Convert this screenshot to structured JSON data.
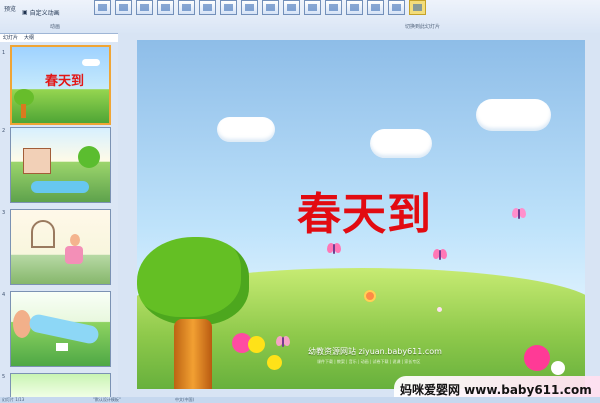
{
  "ribbon": {
    "left_label": "预览",
    "left_button": "自定义动画",
    "group_left": "动画",
    "group_right": "切换到此幻灯片",
    "icons": [
      "transition-1",
      "transition-2",
      "transition-3",
      "transition-4",
      "transition-5",
      "transition-6",
      "transition-7",
      "transition-8",
      "transition-9",
      "transition-10",
      "transition-11",
      "transition-12",
      "transition-13",
      "transition-14",
      "transition-15",
      "transition-16"
    ]
  },
  "thumbnail_pane": {
    "tabs": [
      "幻灯片",
      "大纲"
    ],
    "slides": [
      {
        "num": "1",
        "type": "title"
      },
      {
        "num": "2",
        "type": "village"
      },
      {
        "num": "3",
        "type": "window"
      },
      {
        "num": "4",
        "type": "river"
      },
      {
        "num": "5",
        "type": "partial"
      }
    ]
  },
  "slide": {
    "title": "春天到",
    "site_text": "幼教资源网站 ziyuan.baby611.com",
    "small_text": "课件下载 | 教案 | 音乐 | 动画 | 试卷下载 | 说课 | 家长专区"
  },
  "watermark": {
    "text": "妈咪爱婴网 www.baby611.com"
  },
  "statusbar": {
    "left": "幻灯片 1/13",
    "center": "\"默认设计模板\"",
    "right": "中文(中国)"
  }
}
